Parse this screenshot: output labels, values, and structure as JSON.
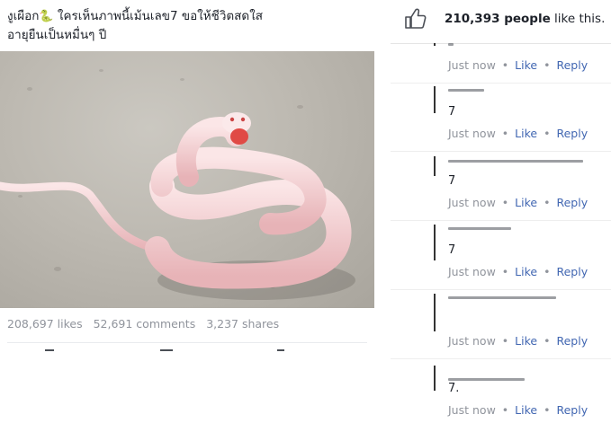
{
  "post": {
    "caption_line1": "งูเผือก",
    "caption_emoji": "🐍",
    "caption_line1_rest": " ใครเห็นภาพนี้เม้นเลข7 ขอให้ชีวิตสดใส",
    "caption_line2": "อายุยืนเป็นหมื่นๆ ปี",
    "likes": "208,697 likes",
    "comments": "52,691 comments",
    "shares": "3,237 shares"
  },
  "likes_header": {
    "count": "210,393 people",
    "suffix": " like this."
  },
  "comments": [
    {
      "text": "",
      "time": "Just now",
      "like": "Like",
      "reply": "Reply"
    },
    {
      "text": "7",
      "time": "Just now",
      "like": "Like",
      "reply": "Reply"
    },
    {
      "text": "7",
      "time": "Just now",
      "like": "Like",
      "reply": "Reply"
    },
    {
      "text": "7",
      "time": "Just now",
      "like": "Like",
      "reply": "Reply"
    },
    {
      "text": "",
      "time": "Just now",
      "like": "Like",
      "reply": "Reply"
    },
    {
      "text": "7.",
      "time": "Just now",
      "like": "Like",
      "reply": "Reply"
    }
  ],
  "colors": {
    "link": "#4267b2",
    "meta": "#90949c",
    "text": "#1d2129",
    "snake": "#f3cdd0"
  },
  "icons": {
    "like_header": "thumbs-up-icon"
  }
}
